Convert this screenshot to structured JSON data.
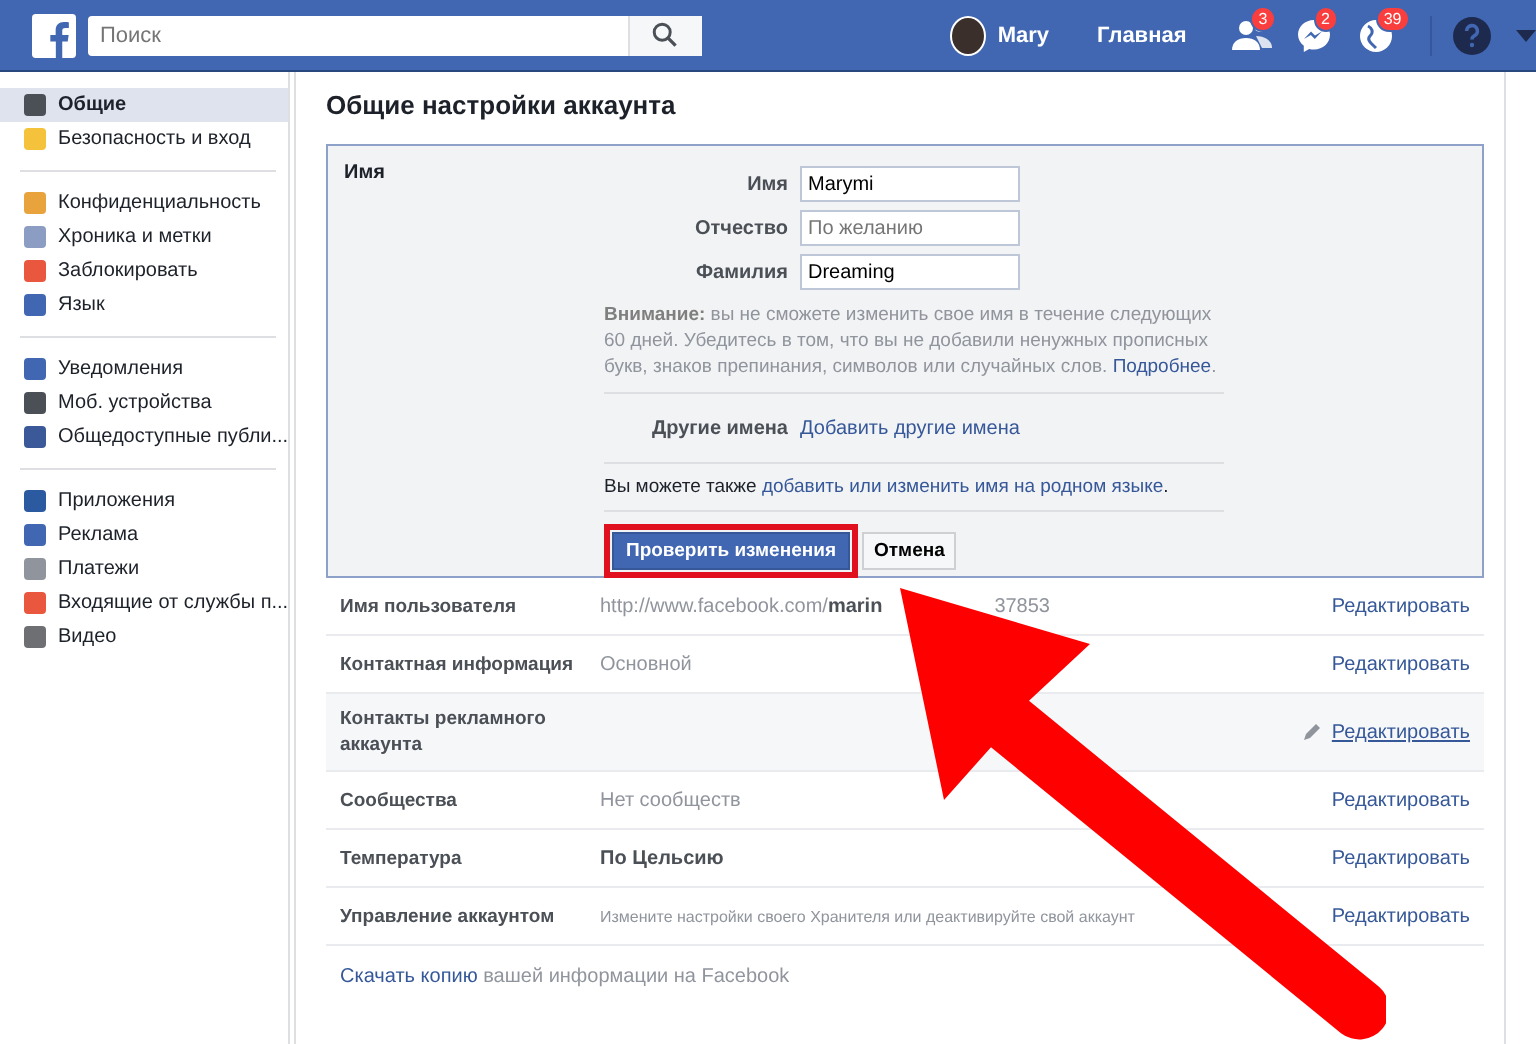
{
  "header": {
    "search": {
      "placeholder": "Поиск"
    },
    "user": "Mary",
    "home": "Главная",
    "notifications": [
      {
        "kind": "friends",
        "count": "3"
      },
      {
        "kind": "messages",
        "count": "2"
      },
      {
        "kind": "globe",
        "count": "39"
      }
    ]
  },
  "sidebar": {
    "groups": [
      [
        {
          "label": "Общие",
          "selected": true
        },
        {
          "label": "Безопасность и вход",
          "selected": false
        }
      ],
      [
        {
          "label": "Конфиденциальность",
          "selected": false
        },
        {
          "label": "Хроника и метки",
          "selected": false
        },
        {
          "label": "Заблокировать",
          "selected": false
        },
        {
          "label": "Язык",
          "selected": false
        }
      ],
      [
        {
          "label": "Уведомления",
          "selected": false
        },
        {
          "label": "Моб. устройства",
          "selected": false
        },
        {
          "label": "Общедоступные публи...",
          "selected": false
        }
      ],
      [
        {
          "label": "Приложения",
          "selected": false
        },
        {
          "label": "Реклама",
          "selected": false
        },
        {
          "label": "Платежи",
          "selected": false
        },
        {
          "label": "Входящие от службы п...",
          "selected": false
        },
        {
          "label": "Видео",
          "selected": false
        }
      ]
    ]
  },
  "main": {
    "title": "Общие настройки аккаунта",
    "name_editor": {
      "label": "Имя",
      "fields": [
        {
          "label": "Имя",
          "value": "Marymi"
        },
        {
          "label": "Отчество",
          "placeholder": "По желанию"
        },
        {
          "label": "Фамилия",
          "value": "Dreaming"
        }
      ],
      "notice": "**Внимание:** вы не сможете изменить свое имя в течение следующих 60 дней. Убедитесь в том, что вы не добавили ненужных прописных букв, знаков препинания, символов или случайных слов.",
      "notice_link": "Подробнее",
      "notice_end": ".",
      "other_names_label": "Другие имена",
      "other_names_link": "Добавить другие имена",
      "native_prefix": "Вы можете также",
      "native_link": "добавить или изменить имя на родном языке",
      "native_end": ".",
      "review_button": "Проверить изменения",
      "cancel_button": "Отмена"
    },
    "rows": [
      {
        "label": "Имя пользователя",
        "value": [
          "http://www.facebook.com/",
          "marin",
          "37853"
        ],
        "kind": "url",
        "action": "Редактировать",
        "highlighted": false
      },
      {
        "label": "Контактная информация",
        "value": [
          "Основной"
        ],
        "kind": "plain",
        "action": "Редактировать",
        "highlighted": false
      },
      {
        "label": "Контакты рекламного аккаунта",
        "value": [],
        "kind": "plain",
        "action": "Редактировать",
        "highlighted": true
      },
      {
        "label": "Сообщества",
        "value": [
          "Нет сообществ"
        ],
        "kind": "plain",
        "action": "Редактировать",
        "highlighted": false
      },
      {
        "label": "Температура",
        "value": [
          "По Цельсию"
        ],
        "kind": "bold",
        "action": "Редактировать",
        "highlighted": false
      },
      {
        "label": "Управление аккаунтом",
        "value": [
          "Измените настройки своего Хранителя или деактивируйте свой аккаунт"
        ],
        "kind": "plain",
        "action": "Редактировать",
        "highlighted": false
      }
    ],
    "footer_link": "Скачать копию",
    "footer_text": "вашей информации на Facebook"
  }
}
